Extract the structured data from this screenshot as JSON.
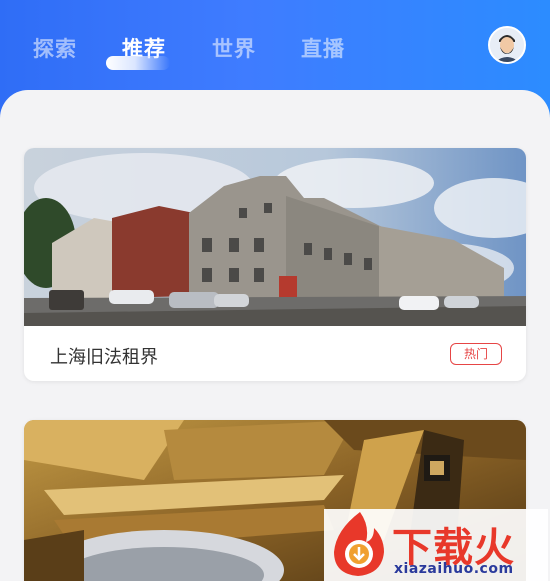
{
  "tabs": [
    {
      "label": "探索",
      "active": false
    },
    {
      "label": "推荐",
      "active": true
    },
    {
      "label": "世界",
      "active": false
    },
    {
      "label": "直播",
      "active": false
    }
  ],
  "header": {
    "avatar": "user-avatar"
  },
  "cards": [
    {
      "title": "上海旧法租界",
      "badge": "热门",
      "image": "street-buildings-photo"
    },
    {
      "title": "",
      "badge": "",
      "image": "wooden-architecture-photo"
    }
  ],
  "watermark": {
    "brand": "下载火",
    "url": "xiazaihuo.com"
  },
  "colors": {
    "header_start": "#2f6df6",
    "header_end": "#2c8cff",
    "badge": "#e64545",
    "brand_red": "#e8382a",
    "brand_blue": "#2a3a9c"
  }
}
